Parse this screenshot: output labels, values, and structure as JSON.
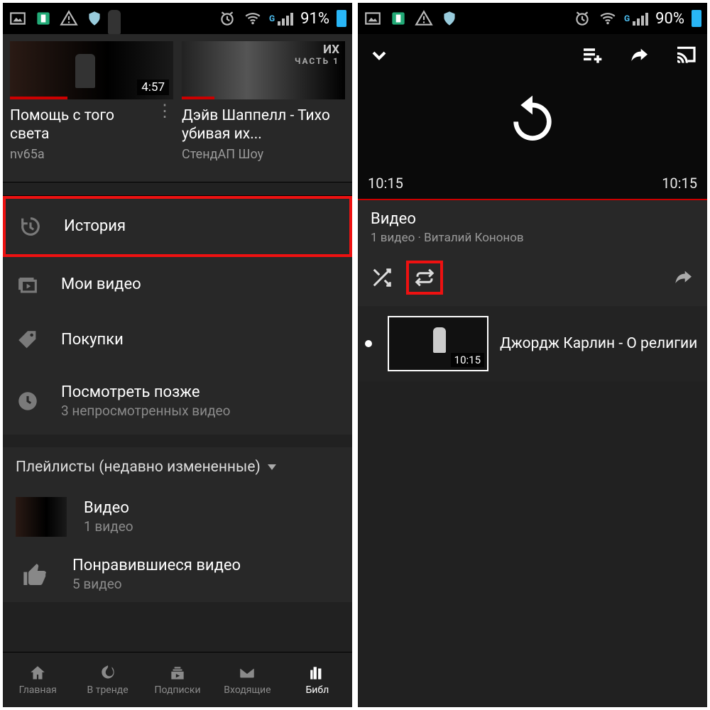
{
  "left": {
    "status": {
      "battery": "91%"
    },
    "cards": [
      {
        "title": "Помощь с того света",
        "channel": "nv65a",
        "duration": "4:57",
        "progress": 35
      },
      {
        "title": "Дэйв Шаппелл - Тихо убивая их...",
        "channel": "СтендАП Шоу",
        "duration": "",
        "progress": 20,
        "overlay_top": "ИХ",
        "overlay_sub": "ЧАСТЬ 1"
      }
    ],
    "library": [
      {
        "id": "history",
        "label": "История",
        "highlight": true
      },
      {
        "id": "my-videos",
        "label": "Мои видео"
      },
      {
        "id": "purchases",
        "label": "Покупки"
      },
      {
        "id": "watch-later",
        "label": "Посмотреть позже",
        "sub": "3 непросмотренных видео"
      }
    ],
    "playlists_header": "Плейлисты (недавно измененные)",
    "playlists": [
      {
        "title": "Видео",
        "sub": "1 видео",
        "thumb": true
      },
      {
        "title": "Понравившиеся видео",
        "sub": "5 видео",
        "like": true
      }
    ],
    "bottomnav": [
      {
        "label": "Главная"
      },
      {
        "label": "В тренде"
      },
      {
        "label": "Подписки"
      },
      {
        "label": "Входящие"
      },
      {
        "label": "Библ"
      }
    ]
  },
  "right": {
    "status": {
      "battery": "90%"
    },
    "player": {
      "left_time": "10:15",
      "right_time": "10:15"
    },
    "playlist": {
      "title": "Видео",
      "sub": "1 видео · Виталий Кононов"
    },
    "video": {
      "title": "Джордж Карлин - О религии",
      "duration": "10:15"
    }
  }
}
